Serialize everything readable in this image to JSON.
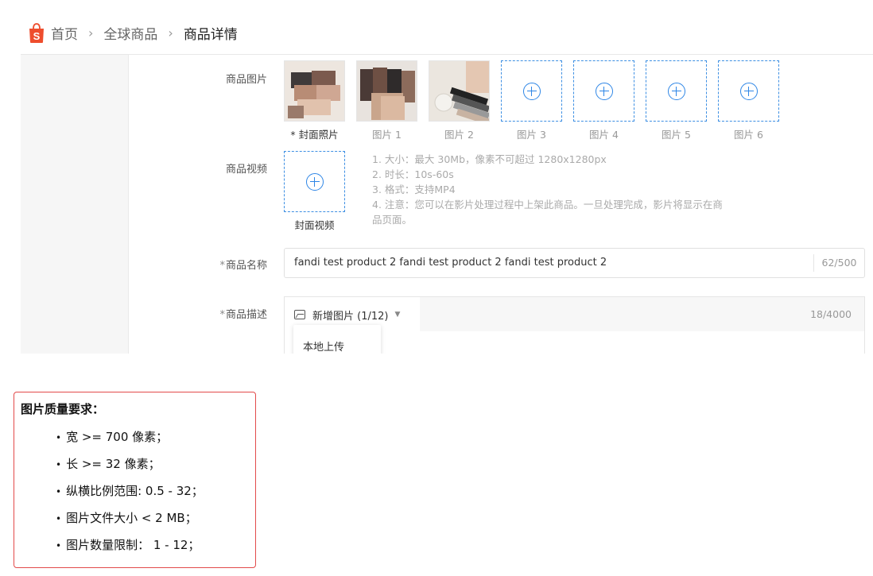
{
  "breadcrumb": {
    "home": "首页",
    "global_products": "全球商品",
    "current": "商品详情"
  },
  "form": {
    "images": {
      "label": "商品图片",
      "cover_caption": "* 封面照片",
      "captions": [
        "图片 1",
        "图片 2",
        "图片 3",
        "图片 4",
        "图片 5",
        "图片 6"
      ]
    },
    "video": {
      "label": "商品视频",
      "caption": "封面视频",
      "hints": [
        "1. 大小：最大 30Mb，像素不可超过 1280x1280px",
        "2. 时长：10s-60s",
        "3. 格式：支持MP4",
        "4. 注意：您可以在影片处理过程中上架此商品。一旦处理完成，影片将显示在商",
        "品页面。"
      ]
    },
    "name": {
      "label_req": "*",
      "label": "商品名称",
      "value": "fandi test product 2 fandi test product 2 fandi test product 2",
      "count": "62/500"
    },
    "description": {
      "label_req": "*",
      "label": "商品描述",
      "add_image": "新增图片 (1/12)",
      "count": "18/4000",
      "dropdown_item": "本地上传"
    }
  },
  "requirements": {
    "title": "图片质量要求：",
    "items": [
      "宽 >= 700 像素；",
      "长 >= 32 像素；",
      "纵横比例范围: 0.5 - 32；",
      "图片文件大小 < 2 MB；",
      "图片数量限制： 1 - 12；"
    ]
  },
  "colors": {
    "brand": "#ee4d2d",
    "accent_blue": "#2e86e6",
    "requirements_border": "#e24a4a"
  }
}
